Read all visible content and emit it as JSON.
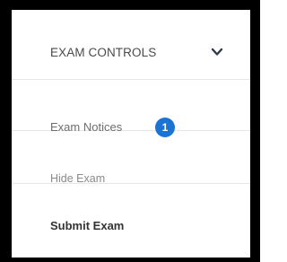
{
  "menu": {
    "title": "EXAM CONTROLS",
    "expand_icon": "chevron-down-icon",
    "items": [
      {
        "label": "Exam Notices",
        "badge": "1"
      },
      {
        "label": "Hide Exam"
      },
      {
        "label": "Submit Exam"
      }
    ]
  },
  "colors": {
    "badge": "#1b73d3",
    "frame": "#000000"
  }
}
